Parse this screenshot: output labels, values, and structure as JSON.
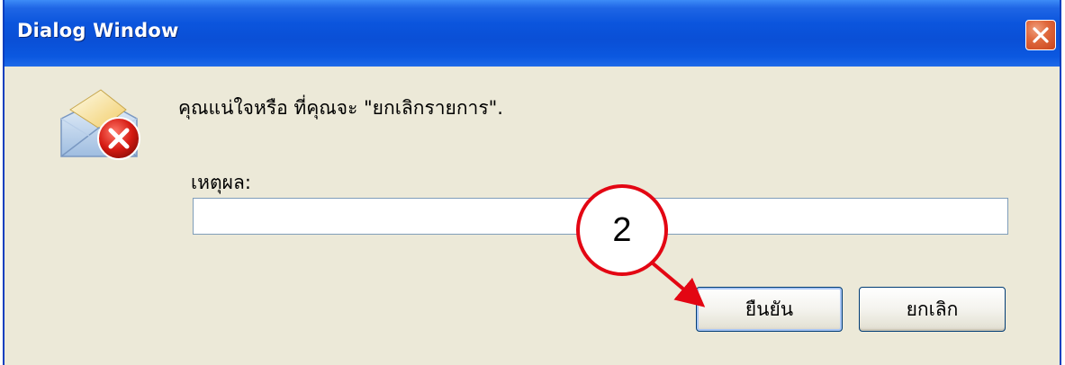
{
  "window": {
    "title": "Dialog Window"
  },
  "dialog": {
    "message": "คุณแน่ใจหรือ ที่คุณจะ \"ยกเลิกรายการ\".",
    "reason_label": "เหตุผล:",
    "reason_value": "",
    "confirm_label": "ยืนยัน",
    "cancel_label": "ยกเลิก",
    "icon": "mail-error-icon"
  },
  "annotation": {
    "step_number": "2",
    "color": "#e30613"
  },
  "colors": {
    "titlebar": "#0a4fd6",
    "body": "#ece9d8",
    "close_button": "#e06a3e"
  }
}
